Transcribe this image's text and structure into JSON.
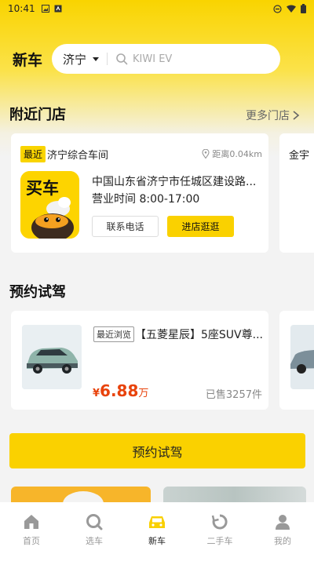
{
  "status": {
    "time": "10:41"
  },
  "header": {
    "title": "新车",
    "city": "济宁",
    "search_placeholder": "KIWI EV"
  },
  "nearby": {
    "title": "附近门店",
    "more": "更多门店",
    "stores": [
      {
        "badge": "最近",
        "name": "济宁综合车间",
        "distance": "距离0.04km",
        "logo_text": "买车",
        "address": "中国山东省济宁市任城区建设路...",
        "hours": "营业时间 8:00-17:00",
        "call_label": "联系电话",
        "visit_label": "进店逛逛"
      },
      {
        "name": "金宇"
      }
    ]
  },
  "test_drive": {
    "title": "预约试驾",
    "cars": [
      {
        "badge": "最近浏览",
        "title": "【五菱星辰】5座SUV尊...",
        "currency": "¥",
        "price": "6.88",
        "unit": "万",
        "sold": "已售3257件"
      }
    ],
    "book_label": "预约试驾"
  },
  "tabbar": {
    "items": [
      {
        "label": "首页",
        "icon": "home-icon"
      },
      {
        "label": "选车",
        "icon": "search-car-icon"
      },
      {
        "label": "新车",
        "icon": "car-icon",
        "active": true
      },
      {
        "label": "二手车",
        "icon": "refresh-icon"
      },
      {
        "label": "我的",
        "icon": "user-icon"
      }
    ]
  },
  "colors": {
    "brand_yellow": "#fad100",
    "price_red": "#e8430c"
  }
}
